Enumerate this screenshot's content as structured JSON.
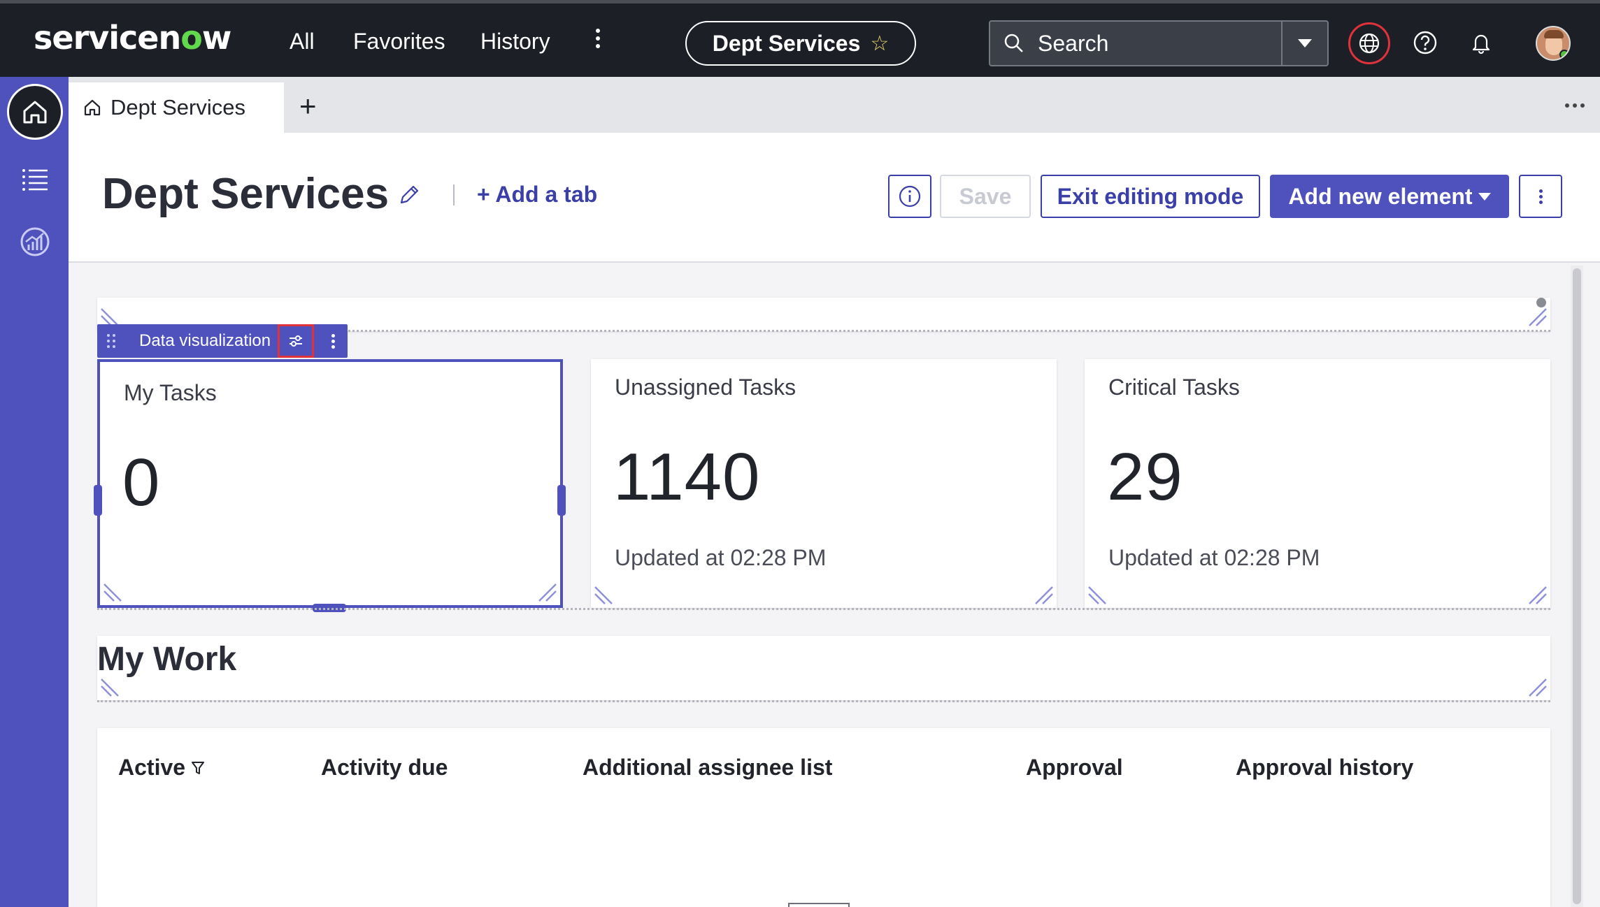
{
  "topnav": {
    "logo_pre": "servicen",
    "logo_o": "o",
    "logo_post": "w",
    "links": [
      "All",
      "Favorites",
      "History"
    ],
    "app_pill": "Dept Services",
    "search_placeholder": "Search"
  },
  "tabs": {
    "active_label": "Dept Services",
    "add_label": "+"
  },
  "header": {
    "title": "Dept Services",
    "add_tab": "+ Add a tab",
    "save": "Save",
    "exit": "Exit editing mode",
    "add_new": "Add new element"
  },
  "toolbar": {
    "label": "Data visualization"
  },
  "cards": [
    {
      "title": "My Tasks",
      "value": "0",
      "updated": ""
    },
    {
      "title": "Unassigned Tasks",
      "value": "1140",
      "updated": "Updated at 02:28 PM"
    },
    {
      "title": "Critical Tasks",
      "value": "29",
      "updated": "Updated at 02:28 PM"
    }
  ],
  "mywork": {
    "title": "My Work"
  },
  "table": {
    "columns": [
      "Active",
      "Activity due",
      "Additional assignee list",
      "Approval",
      "Approval history"
    ]
  },
  "colors": {
    "accent": "#4f52bd",
    "nav_bg": "#1c1f26",
    "highlight": "#e0323c"
  }
}
